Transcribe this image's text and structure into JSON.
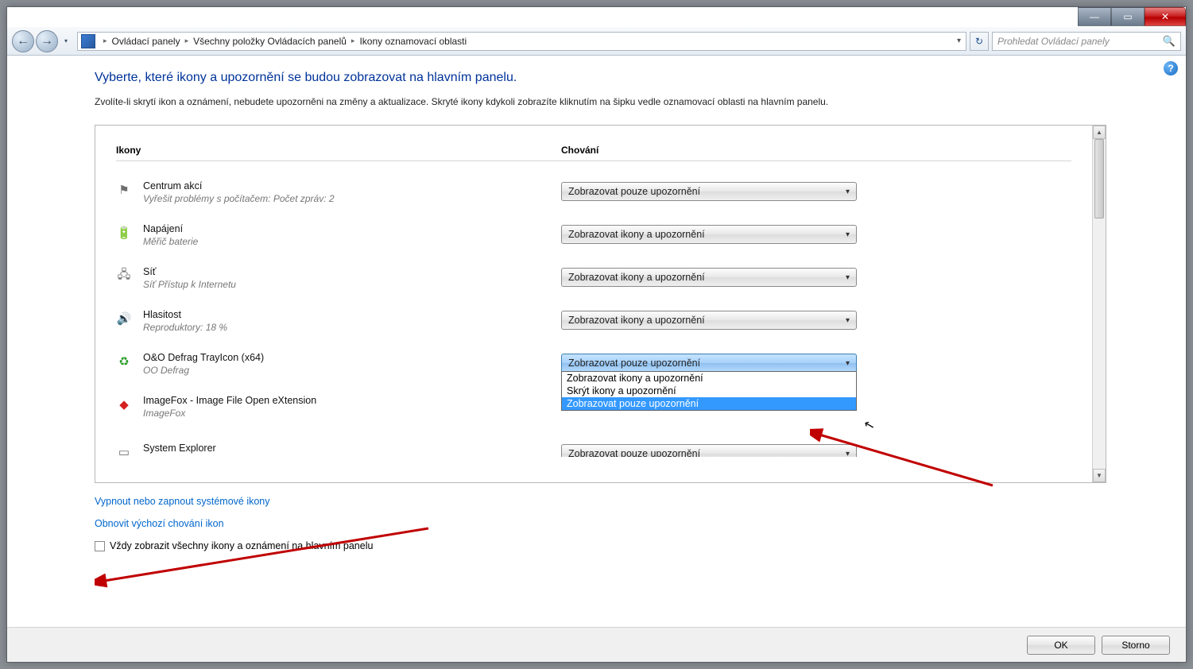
{
  "titlebar": {
    "minimize": "—",
    "maximize": "▭",
    "close": "✕"
  },
  "nav": {
    "back": "←",
    "forward": "→",
    "breadcrumb": [
      "Ovládací panely",
      "Všechny položky Ovládacích panelů",
      "Ikony oznamovací oblasti"
    ],
    "sep": "▸",
    "refresh": "↻",
    "search_placeholder": "Prohledat Ovládací panely"
  },
  "help": "?",
  "heading": "Vyberte, které ikony a upozornění se budou zobrazovat na hlavním panelu.",
  "subtext": "Zvolíte-li skrytí ikon a oznámení, nebudete upozorněni na změny a aktualizace. Skryté ikony kdykoli zobrazíte kliknutím na šipku vedle oznamovací oblasti na hlavním panelu.",
  "columns": {
    "icons": "Ikony",
    "behavior": "Chování"
  },
  "rows": [
    {
      "icon": "⚑",
      "title": "Centrum akcí",
      "sub": "Vyřešit problémy s počítačem: Počet zpráv: 2",
      "value": "Zobrazovat pouze upozornění"
    },
    {
      "icon": "🔋",
      "title": "Napájení",
      "sub": "Měřič baterie",
      "value": "Zobrazovat ikony a upozornění"
    },
    {
      "icon": "🖧",
      "title": "Síť",
      "sub": "Síť Přístup k Internetu",
      "value": "Zobrazovat ikony a upozornění"
    },
    {
      "icon": "🔊",
      "title": "Hlasitost",
      "sub": "Reproduktory: 18 %",
      "value": "Zobrazovat ikony a upozornění"
    },
    {
      "icon": "♻",
      "iconColor": "#2a9c2a",
      "title": "O&O Defrag TrayIcon (x64)",
      "sub": "OO Defrag",
      "value": "Zobrazovat pouze upozornění",
      "open": true
    },
    {
      "icon": "◆",
      "iconColor": "#d62020",
      "title": "ImageFox - Image File Open eXtension",
      "sub": "ImageFox",
      "value": ""
    },
    {
      "icon": "▭",
      "title": "System Explorer",
      "sub": "",
      "value": "Zobrazovat pouze upozornění",
      "cut": true
    }
  ],
  "dropdown_options": [
    "Zobrazovat ikony a upozornění",
    "Skrýt ikony a upozornění",
    "Zobrazovat pouze upozornění"
  ],
  "dropdown_selected_index": 2,
  "links": {
    "system_icons": "Vypnout nebo zapnout systémové ikony",
    "restore_defaults": "Obnovit výchozí chování ikon"
  },
  "checkbox_label": "Vždy zobrazit všechny ikony a oznámení na hlavním panelu",
  "footer": {
    "ok": "OK",
    "cancel": "Storno"
  }
}
